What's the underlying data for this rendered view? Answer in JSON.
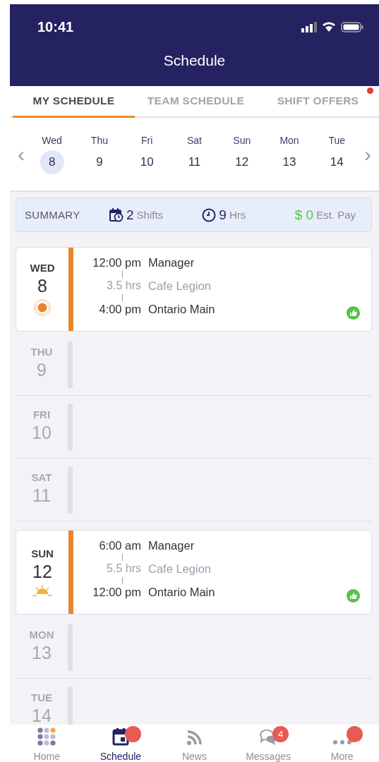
{
  "status_bar": {
    "time": "10:41"
  },
  "header": {
    "title": "Schedule"
  },
  "tabs": [
    {
      "label": "MY SCHEDULE",
      "selected": true,
      "dot": false
    },
    {
      "label": "TEAM SCHEDULE",
      "selected": false,
      "dot": false
    },
    {
      "label": "SHIFT OFFERS",
      "selected": false,
      "dot": true
    }
  ],
  "week": {
    "prev": "‹",
    "next": "›",
    "days": [
      {
        "weekday": "Wed",
        "date": "8",
        "selected": true
      },
      {
        "weekday": "Thu",
        "date": "9",
        "selected": false
      },
      {
        "weekday": "Fri",
        "date": "10",
        "selected": false
      },
      {
        "weekday": "Sat",
        "date": "11",
        "selected": false
      },
      {
        "weekday": "Sun",
        "date": "12",
        "selected": false
      },
      {
        "weekday": "Mon",
        "date": "13",
        "selected": false
      },
      {
        "weekday": "Tue",
        "date": "14",
        "selected": false
      }
    ]
  },
  "summary": {
    "label": "SUMMARY",
    "shifts": "2",
    "shifts_unit": "Shifts",
    "hours": "9",
    "hours_unit": "Hrs",
    "pay": "$ 0",
    "pay_unit": "Est. Pay"
  },
  "days": [
    {
      "kind": "shift",
      "weekday": "WED",
      "date": "8",
      "start": "12:00 pm",
      "duration": "3.5 hrs",
      "end": "4:00 pm",
      "role": "Manager",
      "place": "Cafe Legion",
      "location": "Ontario Main"
    },
    {
      "kind": "empty",
      "weekday": "THU",
      "date": "9"
    },
    {
      "kind": "empty",
      "weekday": "FRI",
      "date": "10"
    },
    {
      "kind": "empty",
      "weekday": "SAT",
      "date": "11"
    },
    {
      "kind": "shift",
      "weekday": "SUN",
      "date": "12",
      "start": "6:00 am",
      "duration": "5.5 hrs",
      "end": "12:00 pm",
      "role": "Manager",
      "place": "Cafe Legion",
      "location": "Ontario Main"
    },
    {
      "kind": "empty",
      "weekday": "MON",
      "date": "13"
    },
    {
      "kind": "empty",
      "weekday": "TUE",
      "date": "14"
    }
  ],
  "nav": [
    {
      "kind": "home",
      "label": "Home",
      "selected": false,
      "dot": false
    },
    {
      "kind": "schedule",
      "label": "Schedule",
      "selected": true,
      "dot": true
    },
    {
      "kind": "news",
      "label": "News",
      "selected": false,
      "dot": false
    },
    {
      "kind": "messages",
      "label": "Messages",
      "selected": false,
      "dot": false,
      "count": "4"
    },
    {
      "kind": "more",
      "label": "More",
      "selected": false,
      "dot": true
    }
  ]
}
